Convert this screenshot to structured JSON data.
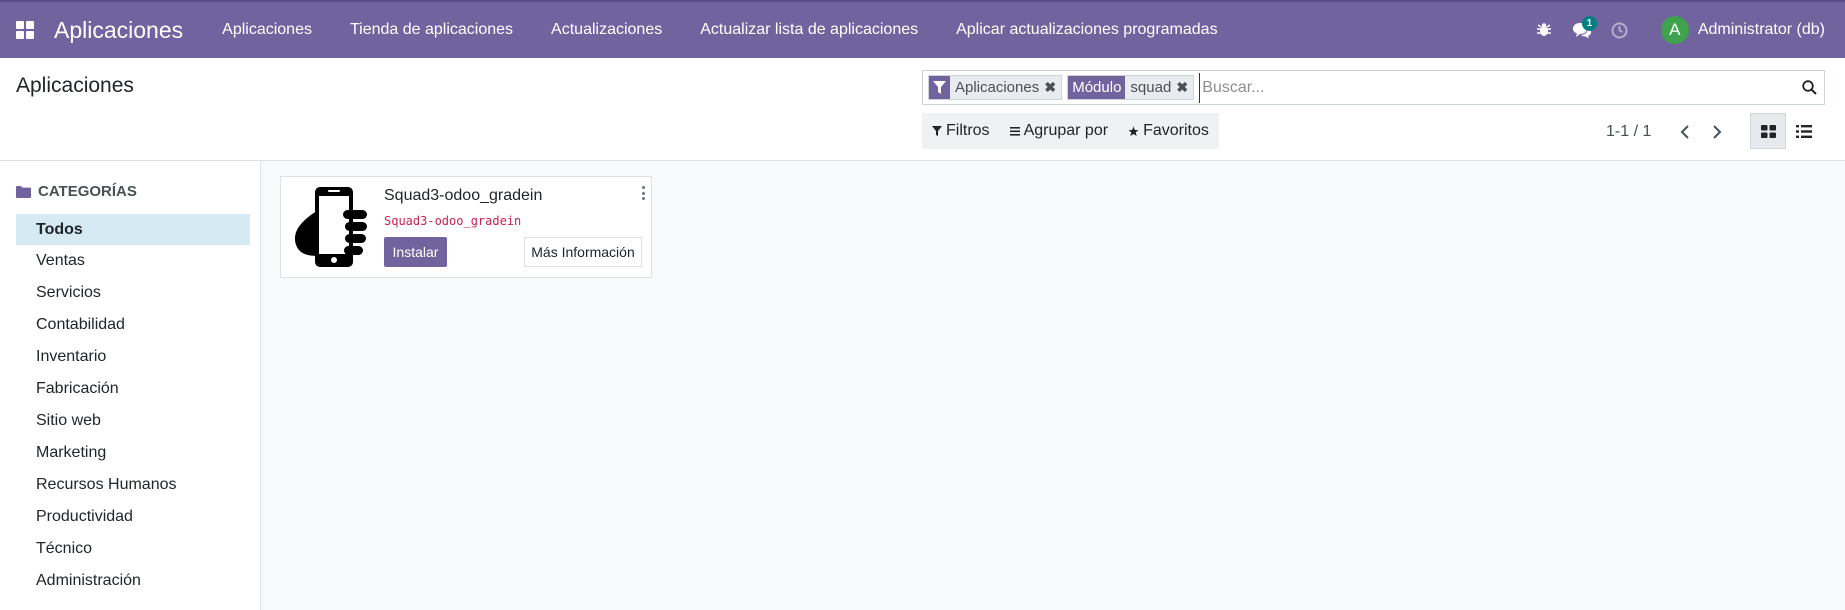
{
  "navbar": {
    "brand": "Aplicaciones",
    "menu": [
      "Aplicaciones",
      "Tienda de aplicaciones",
      "Actualizaciones",
      "Actualizar lista de aplicaciones",
      "Aplicar actualizaciones programadas"
    ],
    "messages_badge": "1",
    "user_initial": "A",
    "user_name": "Administrator (db)",
    "colors": {
      "navbar_bg": "#71639e",
      "avatar_bg": "#3fa34d",
      "badge_bg": "#017e84"
    },
    "icons": [
      "apps-grid-icon",
      "bug-icon",
      "chat-icon",
      "clock-icon"
    ]
  },
  "control_panel": {
    "title": "Aplicaciones",
    "facets": [
      {
        "label_icon": "filter-icon",
        "values": "Aplicaciones"
      },
      {
        "label": "Módulo",
        "values": "squad"
      }
    ],
    "search_placeholder": "Buscar...",
    "options": {
      "filters": "Filtros",
      "group_by": "Agrupar por",
      "favorites": "Favoritos"
    },
    "pager": "1-1 / 1",
    "views": [
      "kanban-icon",
      "list-icon"
    ]
  },
  "sidebar": {
    "header": "CATEGORÍAS",
    "items": [
      "Todos",
      "Ventas",
      "Servicios",
      "Contabilidad",
      "Inventario",
      "Fabricación",
      "Sitio web",
      "Marketing",
      "Recursos Humanos",
      "Productividad",
      "Técnico",
      "Administración"
    ],
    "selected": "Todos"
  },
  "kanban": {
    "cards": [
      {
        "name": "Squad3-odoo_gradein",
        "technical_name": "Squad3-odoo_gradein",
        "install_label": "Instalar",
        "info_label": "Más Información",
        "icon": "mobile-hand-icon"
      }
    ]
  }
}
